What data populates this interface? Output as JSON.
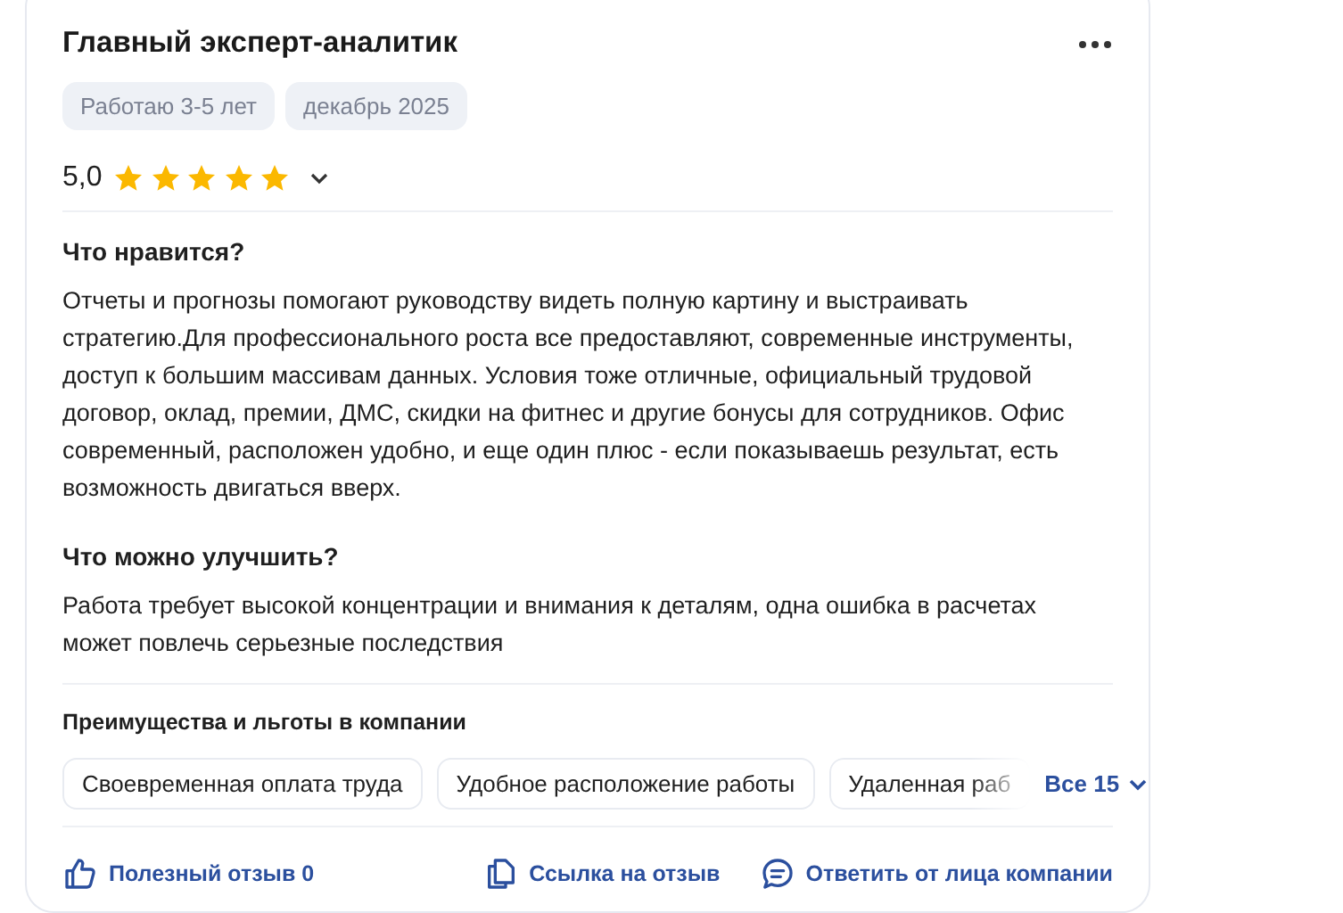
{
  "review": {
    "title": "Главный эксперт-аналитик",
    "tags": [
      "Работаю 3-5 лет",
      "декабрь 2025"
    ],
    "rating": {
      "value": "5,0",
      "stars": 5
    },
    "sections": [
      {
        "heading": "Что нравится?",
        "text": "Отчеты и прогнозы помогают руководству видеть полную картину и выстраивать стратегию.Для профессионального роста все предоставляют, современные инструменты, доступ к большим массивам данных. Условия тоже отличные, официальный трудовой договор, оклад, премии, ДМС, скидки на фитнес и другие бонусы для сотрудников. Офис современный, расположен удобно, и еще один плюс - если показываешь результат, есть возможность двигаться вверх."
      },
      {
        "heading": "Что можно улучшить?",
        "text": "Работа требует высокой концентрации и внимания к деталям, одна ошибка в расчетах может повлечь серьезные последствия"
      }
    ],
    "benefits": {
      "heading": "Преимущества и льготы в компании",
      "items": [
        "Своевременная оплата труда",
        "Удобное расположение работы",
        "Удаленная раб"
      ],
      "more": "Все 15"
    },
    "actions": [
      {
        "kind": "like",
        "label": "Полезный отзыв 0"
      },
      {
        "kind": "link",
        "label": "Ссылка на отзыв"
      },
      {
        "kind": "reply",
        "label": "Ответить от лица компании"
      }
    ]
  }
}
